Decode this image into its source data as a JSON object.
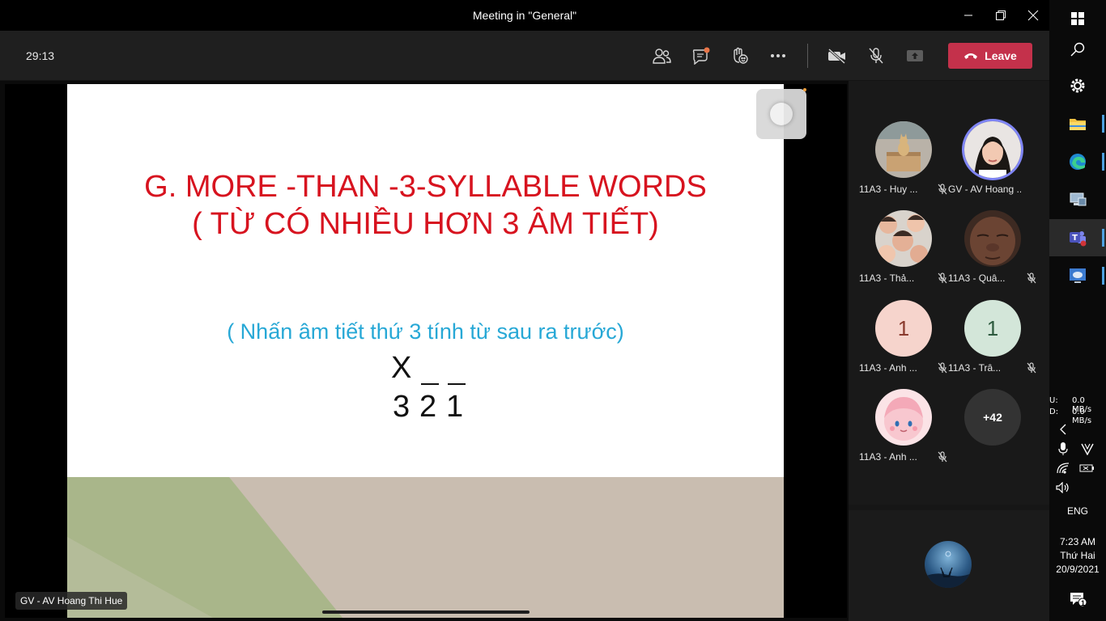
{
  "window": {
    "title": "Meeting in \"General\""
  },
  "toolbar": {
    "timer": "29:13",
    "leave_label": "Leave"
  },
  "slide": {
    "title_line1": "G. MORE -THAN -3-SYLLABLE WORDS",
    "title_line2": "( TỪ CÓ NHIỀU HƠN 3 ÂM TIẾT)",
    "subtitle": "( Nhấn âm tiết thứ 3 tính từ sau ra trước)",
    "mark_symbol": "X",
    "digits": [
      "3",
      "2",
      "1"
    ]
  },
  "presenter": {
    "name": "GV - AV Hoang Thi Hue"
  },
  "participants": [
    {
      "name": "11A3 - Huy ...",
      "initial": ""
    },
    {
      "name": "GV - AV Hoang ...",
      "initial": ""
    },
    {
      "name": "11A3 - Thả...",
      "initial": ""
    },
    {
      "name": "11A3 - Quâ...",
      "initial": ""
    },
    {
      "name": "11A3 - Anh ...",
      "initial": "1"
    },
    {
      "name": "11A3 - Trâ...",
      "initial": "1"
    },
    {
      "name": "11A3 - Anh ...",
      "initial": ""
    }
  ],
  "more_participants": "+42",
  "taskbar": {
    "upload_label": "U:",
    "upload_value": "0.0 MB/s",
    "download_label": "D:",
    "download_value": "0.0 MB/s",
    "language": "ENG",
    "time": "7:23 AM",
    "day": "Thứ Hai",
    "date": "20/9/2021",
    "notification_count": "1"
  },
  "colors": {
    "leave": "#c4314b",
    "slide_title": "#d7131f",
    "slide_subtitle": "#27a8d6",
    "ring": "#7f85f5"
  }
}
